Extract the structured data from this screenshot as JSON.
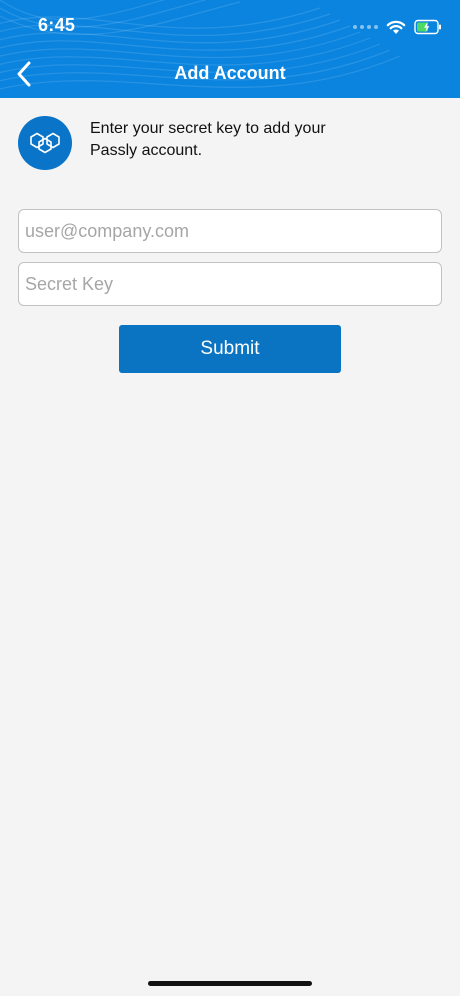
{
  "status_bar": {
    "time": "6:45"
  },
  "header": {
    "title": "Add Account"
  },
  "intro": {
    "line1": "Enter your secret key to add your",
    "line2": "Passly account."
  },
  "form": {
    "email_placeholder": "user@company.com",
    "email_value": "",
    "secret_placeholder": "Secret Key",
    "secret_value": "",
    "submit_label": "Submit"
  },
  "icons": {
    "back": "chevron-left-icon",
    "logo": "passly-logo-icon",
    "wifi": "wifi-icon",
    "battery": "battery-charging-icon"
  },
  "colors": {
    "header_bg": "#0a84df",
    "accent": "#0a74c2",
    "page_bg": "#f4f4f4",
    "battery_fill": "#4cd964"
  }
}
